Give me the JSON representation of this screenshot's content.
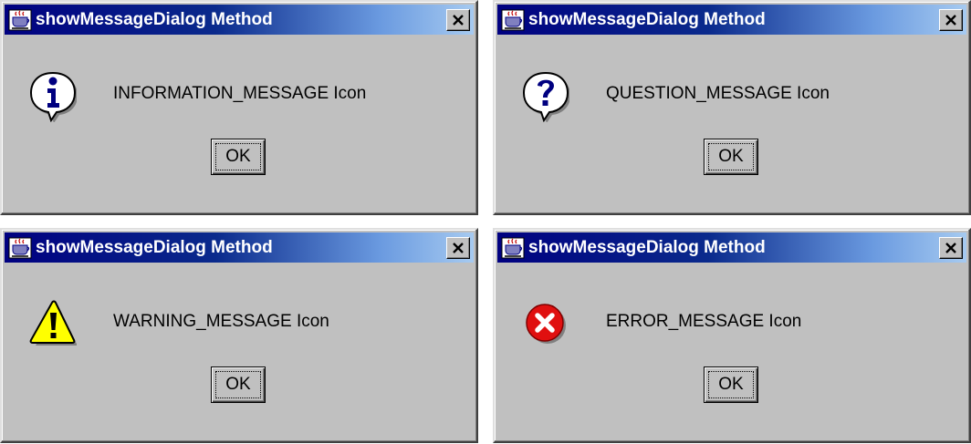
{
  "dialogs": [
    {
      "title": "showMessageDialog Method",
      "icon": "information-icon",
      "message": "INFORMATION_MESSAGE Icon",
      "ok_label": "OK"
    },
    {
      "title": "showMessageDialog Method",
      "icon": "question-icon",
      "message": "QUESTION_MESSAGE Icon",
      "ok_label": "OK"
    },
    {
      "title": "showMessageDialog Method",
      "icon": "warning-icon",
      "message": "WARNING_MESSAGE Icon",
      "ok_label": "OK"
    },
    {
      "title": "showMessageDialog Method",
      "icon": "error-icon",
      "message": "ERROR_MESSAGE Icon",
      "ok_label": "OK"
    }
  ],
  "colors": {
    "dialog_background": "#c0c0c0",
    "titlebar_start": "#000080",
    "titlebar_end": "#a6caf0",
    "title_text": "#ffffff",
    "warning_fill": "#ffff00",
    "error_fill": "#e01010"
  }
}
